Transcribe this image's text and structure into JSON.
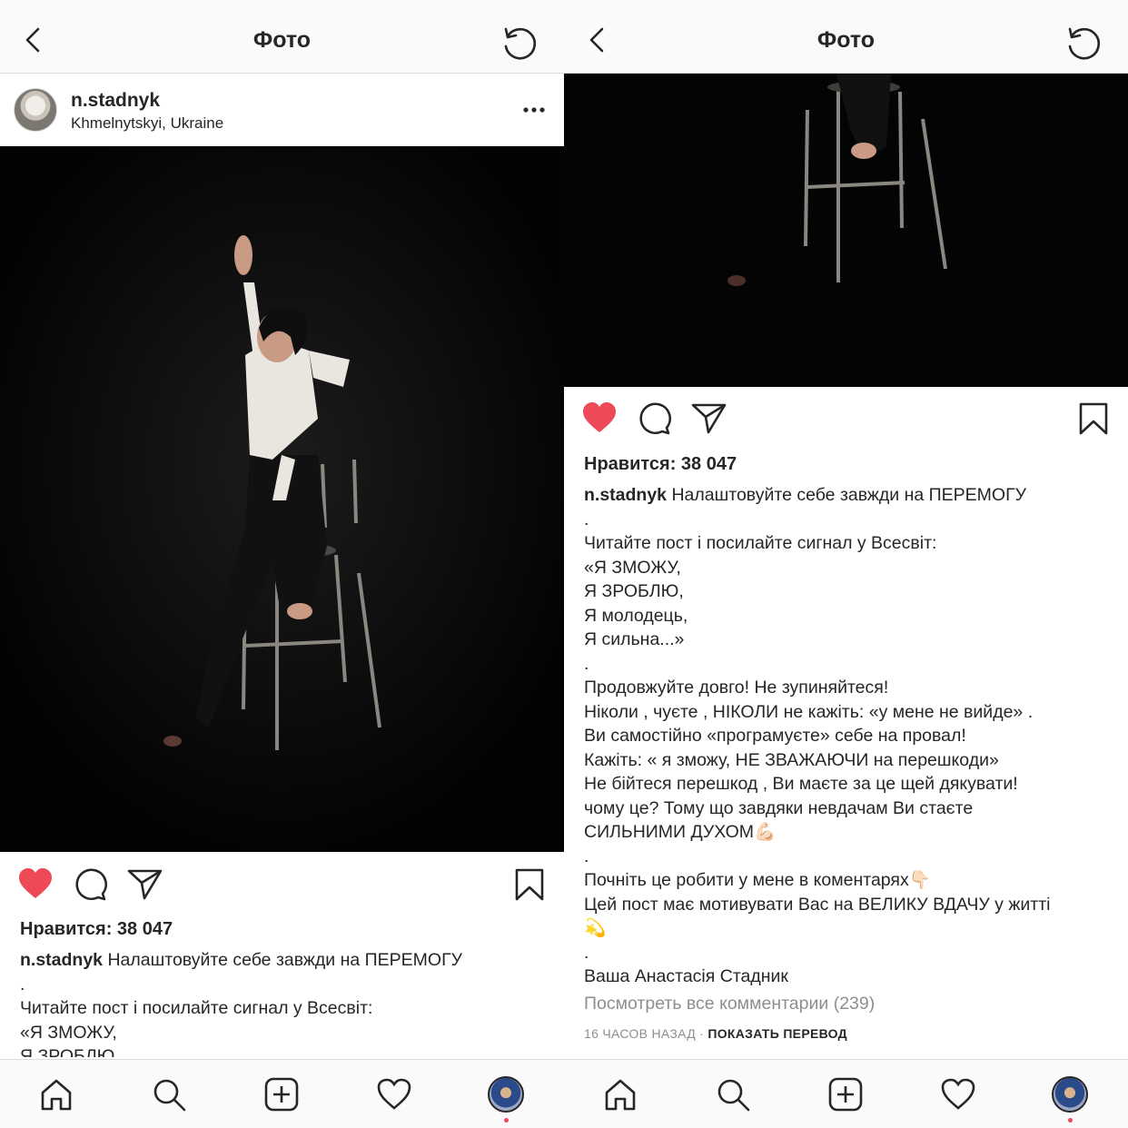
{
  "nav": {
    "title": "Фото",
    "back_icon": "chevron-left-icon",
    "refresh_icon": "refresh-icon"
  },
  "post": {
    "username": "n.stadnyk",
    "location": "Khmelnytskyi, Ukraine",
    "likes": "Нравится: 38 047",
    "caption_first": "Налаштовуйте себе завжди на ПЕРЕМОГУ",
    "caption_lines": [
      ".",
      "Читайте пост і посилайте сигнал у Всесвіт:",
      "«Я ЗМОЖУ,",
      "Я ЗРОБЛЮ,",
      "Я молодець,",
      "Я сильна...»",
      ".",
      "Продовжуйте довго! Не зупиняйтеся!",
      "Ніколи , чуєте , НІКОЛИ не кажіть: «у мене не вийде» .",
      "Ви самостійно «програмуєте» себе на провал!",
      "Кажіть: « я зможу, НЕ ЗВАЖАЮЧИ на перешкоди»",
      "Не бійтеся перешкод , Ви маєте за це щей дякувати!",
      "чому це? Тому що завдяки невдачам Ви стаєте",
      "СИЛЬНИМИ ДУХОМ💪🏻",
      ".",
      "Почніть це робити у мене в коментарях👇🏻",
      "Цей пост має мотивувати Вас на ВЕЛИКУ ВДАЧУ у житті",
      "💫",
      ".",
      "Ваша Анастасія Стадник"
    ],
    "view_comments": "Посмотреть все комментарии (239)",
    "time": "16 ЧАСОВ НАЗАД",
    "separator": " · ",
    "translate": "ПОКАЗАТЬ ПЕРЕВОД"
  },
  "colors": {
    "like_red": "#ed4956",
    "text": "#262626",
    "muted": "#8e8e8e",
    "photo_bg": "#050505"
  }
}
